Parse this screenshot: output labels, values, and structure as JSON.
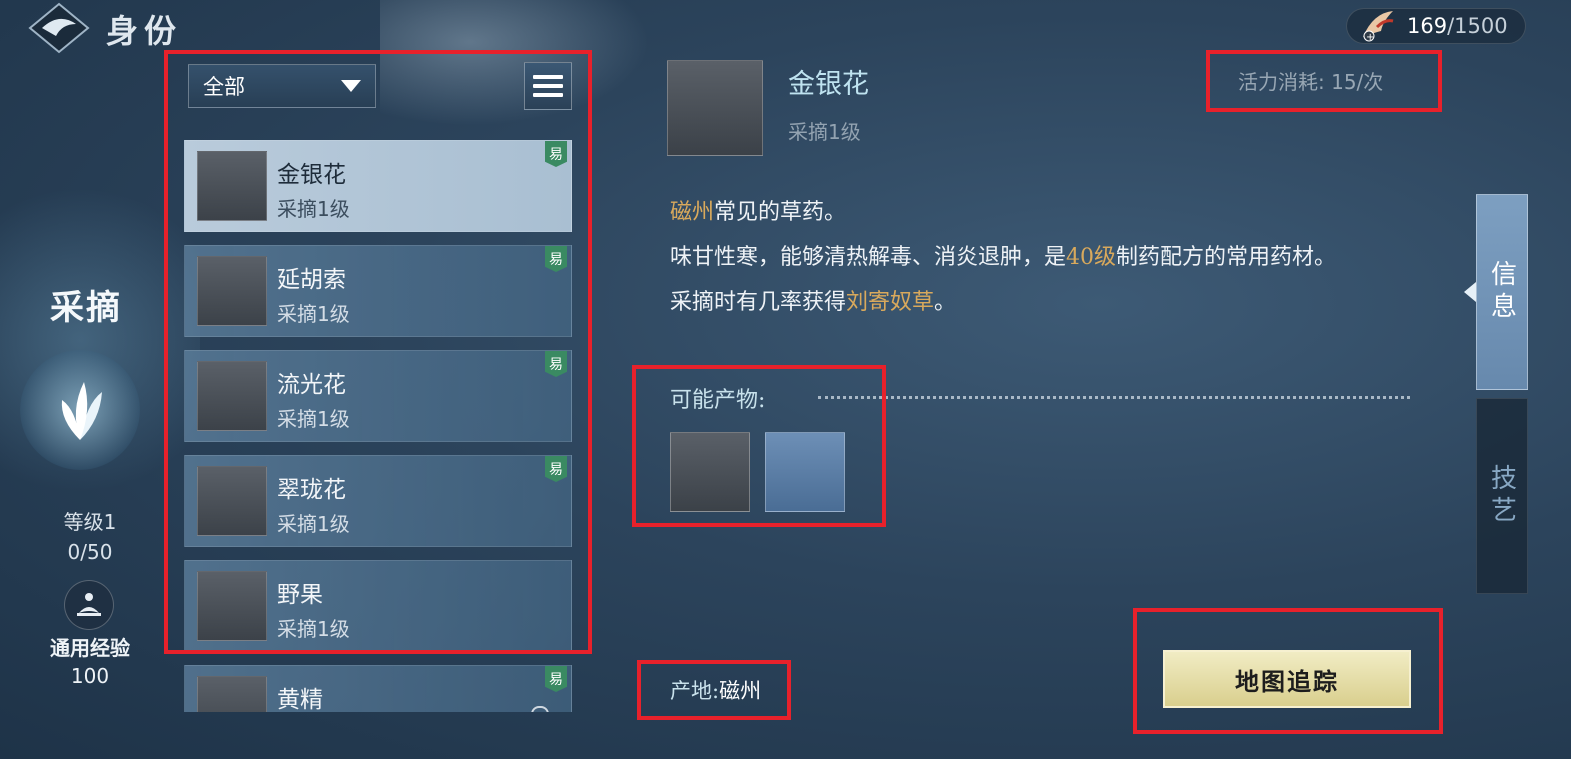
{
  "header": {
    "title": "身份",
    "stamina_current": "169",
    "stamina_max": "/1500"
  },
  "profile": {
    "category": "采摘",
    "level": "等级1",
    "exp": "0/50",
    "general_exp_label": "通用经验",
    "general_exp_value": "100"
  },
  "list": {
    "filter_value": "全部",
    "items": [
      {
        "name": "金银花",
        "sub": "采摘1级",
        "badge": "易",
        "selected": true
      },
      {
        "name": "延胡索",
        "sub": "采摘1级",
        "badge": "易"
      },
      {
        "name": "流光花",
        "sub": "采摘1级",
        "badge": "易"
      },
      {
        "name": "翠珑花",
        "sub": "采摘1级",
        "badge": "易"
      },
      {
        "name": "野果",
        "sub": "采摘1级",
        "badge": ""
      },
      {
        "name": "黄精",
        "sub": "",
        "badge": "易"
      }
    ]
  },
  "detail": {
    "name": "金银花",
    "sub": "采摘1级",
    "cost": "活力消耗: 15/次",
    "desc_place": "磁州",
    "desc_line1_rest": "常见的草药。",
    "desc_line2_a": "味甘性寒，能够清热解毒、消炎退肿，是",
    "desc_line2_level": "40级",
    "desc_line2_b": "制药配方的常用药材。",
    "desc_line3_a": "采摘时有几率获得",
    "desc_line3_item": "刘寄奴草",
    "desc_line3_b": "。",
    "products_label": "可能产物:",
    "origin_label": "产地:",
    "origin_value": "磁州",
    "track_button": "地图追踪"
  },
  "tabs": {
    "info": "信息",
    "skill": "技艺"
  },
  "colors": {
    "highlight": "#d9a95c",
    "annotation": "#e8212b",
    "badge": "#3a8a62"
  },
  "icons": [
    "logo-icon",
    "crane-icon",
    "dropdown-caret-icon",
    "menu-icon",
    "leaf-emblem-icon",
    "meditate-icon",
    "lock-icon"
  ]
}
